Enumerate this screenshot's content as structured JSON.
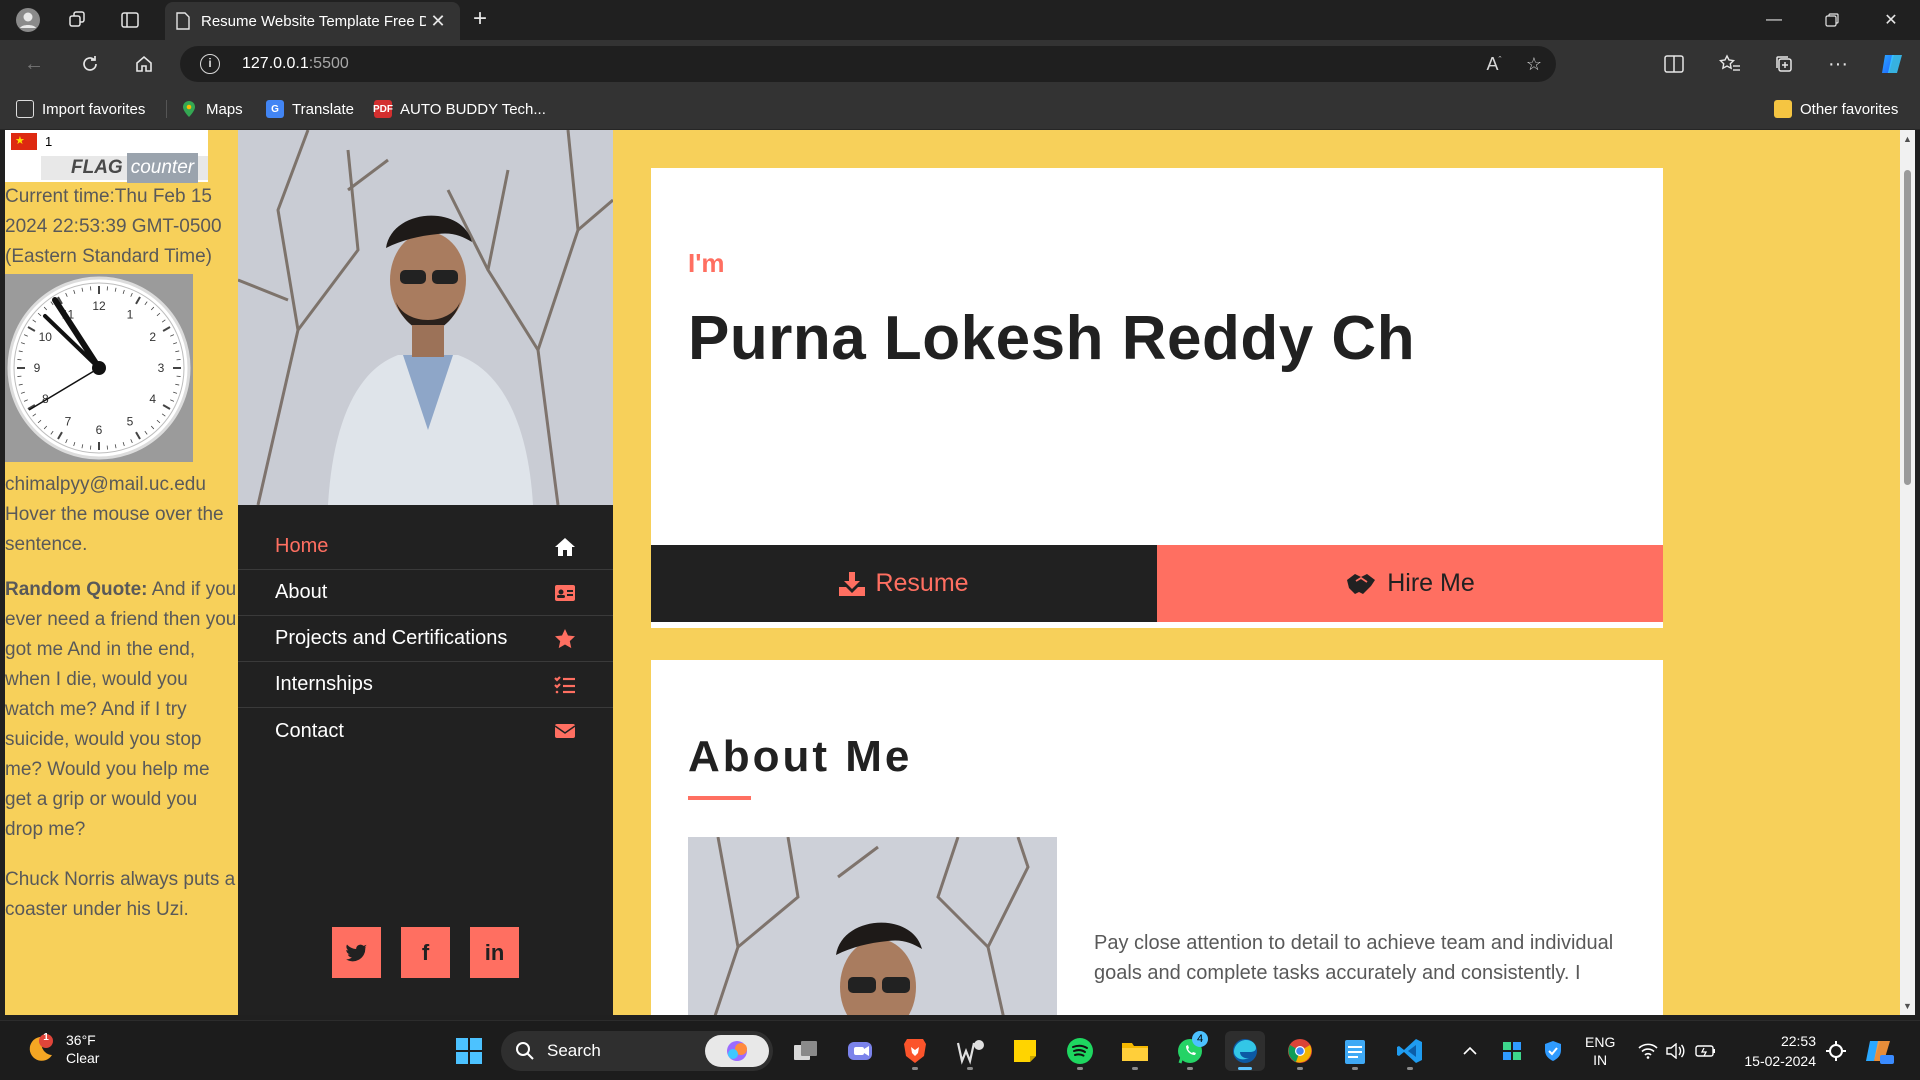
{
  "browser": {
    "tab_title": "Resume Website Template Free D",
    "url_host": "127.0.0.1",
    "url_port": ":5500",
    "favorites": [
      "Import favorites",
      "Maps",
      "Translate",
      "AUTO BUDDY Tech..."
    ],
    "other_favorites": "Other favorites"
  },
  "widgets": {
    "flag_count": "1",
    "flag_brand_1": "FLAG",
    "flag_brand_2": "counter",
    "current_time": "Current time:Thu Feb 15 2024 22:53:39 GMT-0500 (Eastern Standard Time)",
    "clock_numbers": [
      "12",
      "1",
      "2",
      "3",
      "4",
      "5",
      "6",
      "7",
      "8",
      "9",
      "10",
      "11"
    ],
    "email": "chimalpyy@mail.uc.edu",
    "hover_text": "Hover the mouse over the sentence.",
    "quote_label": "Random Quote:",
    "quote_text": " And if you ever need a friend then you got me And in the end, when I die, would you watch me? And if I try suicide, would you stop me? Would you help me get a grip or would you drop me?",
    "chuck_text": "Chuck Norris always puts a coaster under his Uzi."
  },
  "sidebar": {
    "menu": [
      {
        "label": "Home",
        "icon": "home-icon"
      },
      {
        "label": "About",
        "icon": "id-card-icon"
      },
      {
        "label": "Projects and Certifications",
        "icon": "star-icon"
      },
      {
        "label": "Internships",
        "icon": "list-check-icon"
      },
      {
        "label": "Contact",
        "icon": "envelope-icon"
      }
    ],
    "socials": [
      "twitter-icon",
      "facebook-icon",
      "linkedin-icon"
    ]
  },
  "hero": {
    "im": "I'm",
    "name": "Purna Lokesh Reddy Ch",
    "resume_label": "Resume",
    "hire_label": "Hire Me"
  },
  "about": {
    "title": "About Me",
    "text": "Pay close attention to detail to achieve team and individual goals and complete tasks accurately and consistently. I"
  },
  "taskbar": {
    "weather_temp": "36°F",
    "weather_desc": "Clear",
    "weather_badge": "1",
    "search_label": "Search",
    "whatsapp_badge": "4",
    "lang_1": "ENG",
    "lang_2": "IN",
    "time": "22:53",
    "date": "15-02-2024"
  },
  "colors": {
    "accent": "#ff6f61",
    "page_bg": "#f7d05a",
    "sidebar_bg": "#212121"
  }
}
